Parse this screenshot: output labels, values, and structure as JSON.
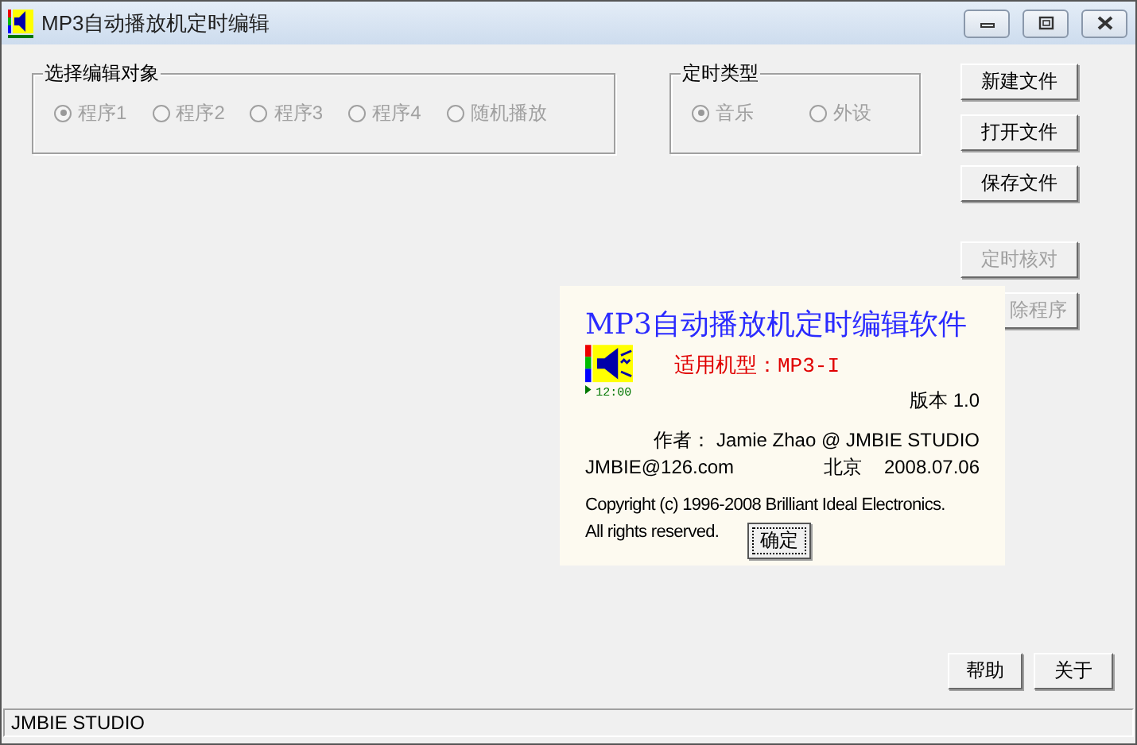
{
  "window": {
    "title": "MP3自动播放机定时编辑"
  },
  "groups": [
    {
      "title": "选择编辑对象",
      "options": [
        {
          "label": "程序1",
          "selected": true,
          "disabled": true
        },
        {
          "label": "程序2",
          "selected": false,
          "disabled": true
        },
        {
          "label": "程序3",
          "selected": false,
          "disabled": true
        },
        {
          "label": "程序4",
          "selected": false,
          "disabled": true
        },
        {
          "label": "随机播放",
          "selected": false,
          "disabled": true
        }
      ]
    },
    {
      "title": "定时类型",
      "options": [
        {
          "label": "音乐",
          "selected": true,
          "disabled": true
        },
        {
          "label": "外设",
          "selected": false,
          "disabled": true
        }
      ]
    }
  ],
  "side_buttons": [
    {
      "label": "新建文件",
      "disabled": false
    },
    {
      "label": "打开文件",
      "disabled": false
    },
    {
      "label": "保存文件",
      "disabled": false
    },
    {
      "label": "定时核对",
      "disabled": true
    },
    {
      "label": "除程序",
      "disabled": true
    }
  ],
  "about_dialog": {
    "title": "MP3自动播放机定时编辑软件",
    "icon_time": "12:00",
    "model": "适用机型：MP3-I",
    "version": "版本 1.0",
    "author": "作者： Jamie Zhao @ JMBIE STUDIO",
    "email": "JMBIE@126.com",
    "city": "北京",
    "date": "2008.07.06",
    "copyright": "Copyright (c) 1996-2008 Brilliant Ideal Electronics.",
    "rights": "All rights reserved.",
    "ok_button": "确定"
  },
  "bottom_buttons": [
    "帮助",
    "关于"
  ],
  "status_bar": "JMBIE STUDIO"
}
